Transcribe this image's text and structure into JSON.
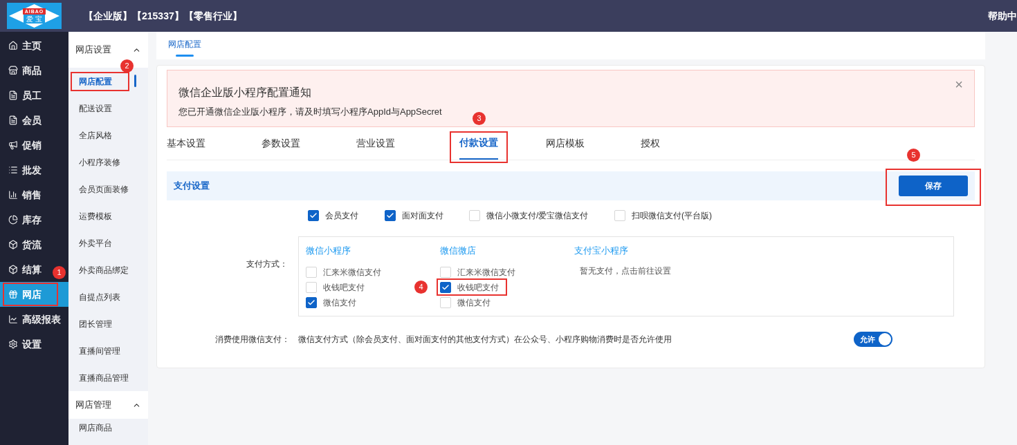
{
  "logo": {
    "brand": "AIBAO",
    "name": "爱 宝"
  },
  "header": {
    "title": "【企业版】【215337】【零售行业】",
    "help": "帮助中"
  },
  "nav": [
    {
      "label": "主页",
      "selected": false
    },
    {
      "label": "商品",
      "selected": false
    },
    {
      "label": "员工",
      "selected": false
    },
    {
      "label": "会员",
      "selected": false
    },
    {
      "label": "促销",
      "selected": false
    },
    {
      "label": "批发",
      "selected": false
    },
    {
      "label": "销售",
      "selected": false
    },
    {
      "label": "库存",
      "selected": false
    },
    {
      "label": "货流",
      "selected": false
    },
    {
      "label": "结算",
      "selected": false
    },
    {
      "label": "网店",
      "selected": true,
      "annotation": "1"
    },
    {
      "label": "高级报表",
      "selected": false
    },
    {
      "label": "设置",
      "selected": false
    }
  ],
  "subnav": [
    {
      "title": "网店设置",
      "expanded": true,
      "items": [
        {
          "label": "网店配置",
          "selected": true,
          "annotation": "2"
        },
        {
          "label": "配送设置",
          "selected": false
        },
        {
          "label": "全店风格",
          "selected": false
        },
        {
          "label": "小程序装修",
          "selected": false
        },
        {
          "label": "会员页面装修",
          "selected": false
        },
        {
          "label": "运费模板",
          "selected": false
        },
        {
          "label": "外卖平台",
          "selected": false
        },
        {
          "label": "外卖商品绑定",
          "selected": false
        },
        {
          "label": "自提点列表",
          "selected": false
        },
        {
          "label": "团长管理",
          "selected": false
        },
        {
          "label": "直播间管理",
          "selected": false
        },
        {
          "label": "直播商品管理",
          "selected": false
        }
      ]
    },
    {
      "title": "网店管理",
      "expanded": true,
      "items": [
        {
          "label": "网店商品",
          "selected": false
        }
      ]
    }
  ],
  "page_tabs": [
    {
      "label": "网店配置",
      "selected": true
    }
  ],
  "notice": {
    "title": "微信企业版小程序配置通知",
    "message": "您已开通微信企业版小程序，请及时填写小程序AppId与AppSecret",
    "close": "×"
  },
  "tabs": [
    {
      "label": "基本设置",
      "selected": false
    },
    {
      "label": "参数设置",
      "selected": false
    },
    {
      "label": "营业设置",
      "selected": false
    },
    {
      "label": "付款设置",
      "selected": true,
      "annotation": "3"
    },
    {
      "label": "网店模板",
      "selected": false
    },
    {
      "label": "授权",
      "selected": false
    }
  ],
  "section": {
    "title": "支付设置",
    "save_button": "保存",
    "annotation": "5"
  },
  "payment_options": [
    {
      "label": "会员支付",
      "checked": true
    },
    {
      "label": "面对面支付",
      "checked": true
    },
    {
      "label": "微信小微支付/爱宝微信支付",
      "checked": false
    },
    {
      "label": "扫呗微信支付(平台版)",
      "checked": false
    }
  ],
  "methods": {
    "label": "支付方式：",
    "groups": [
      {
        "kind": "options",
        "title": "微信小程序",
        "options": [
          {
            "label": "汇来米微信支付",
            "checked": false
          },
          {
            "label": "收钱吧支付",
            "checked": false
          },
          {
            "label": "微信支付",
            "checked": true
          }
        ]
      },
      {
        "kind": "options",
        "title": "微信微店",
        "options": [
          {
            "label": "汇来米微信支付",
            "checked": false
          },
          {
            "label": "收钱吧支付",
            "checked": true,
            "annotation": "4"
          },
          {
            "label": "微信支付",
            "checked": false
          }
        ]
      },
      {
        "kind": "empty",
        "title": "支付宝小程序",
        "message": "暂无支付，点击前往设置"
      }
    ]
  },
  "wechat_consume": {
    "label": "消费使用微信支付：",
    "description": "微信支付方式（除会员支付、面对面支付的其他支付方式）在公众号、小程序购物消费时是否允许使用",
    "toggle": {
      "label": "允许",
      "on": true
    }
  }
}
